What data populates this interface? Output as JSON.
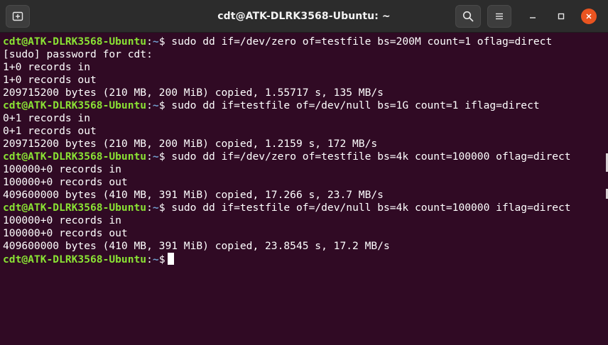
{
  "window": {
    "title": "cdt@ATK-DLRK3568-Ubuntu: ~",
    "icons": [
      "new-tab-icon",
      "search-icon",
      "hamburger-menu-icon",
      "minimize-icon",
      "maximize-icon",
      "close-icon"
    ],
    "colors": {
      "background": "#300a24",
      "titlebar": "#2c2c2c",
      "prompt_user": "#8ae234",
      "prompt_path": "#729fcf",
      "text": "#ffffff",
      "close_button": "#e95420"
    }
  },
  "terminal": {
    "prompt_user": "cdt@ATK-DLRK3568-Ubuntu",
    "prompt_sep": ":",
    "prompt_path": "~",
    "prompt_symbol": "$",
    "blocks": [
      {
        "command": "sudo dd if=/dev/zero of=testfile bs=200M count=1 oflag=direct",
        "output": [
          "[sudo] password for cdt:",
          "1+0 records in",
          "1+0 records out",
          "209715200 bytes (210 MB, 200 MiB) copied, 1.55717 s, 135 MB/s"
        ]
      },
      {
        "command": "sudo dd if=testfile of=/dev/null bs=1G count=1 iflag=direct",
        "output": [
          "0+1 records in",
          "0+1 records out",
          "209715200 bytes (210 MB, 200 MiB) copied, 1.2159 s, 172 MB/s"
        ]
      },
      {
        "command": "sudo dd if=/dev/zero of=testfile bs=4k count=100000 oflag=direct",
        "output": [
          "100000+0 records in",
          "100000+0 records out",
          "409600000 bytes (410 MB, 391 MiB) copied, 17.266 s, 23.7 MB/s"
        ]
      },
      {
        "command": "sudo dd if=testfile of=/dev/null bs=4k count=100000 iflag=direct",
        "output": [
          "100000+0 records in",
          "100000+0 records out",
          "409600000 bytes (410 MB, 391 MiB) copied, 23.8545 s, 17.2 MB/s"
        ]
      }
    ]
  }
}
